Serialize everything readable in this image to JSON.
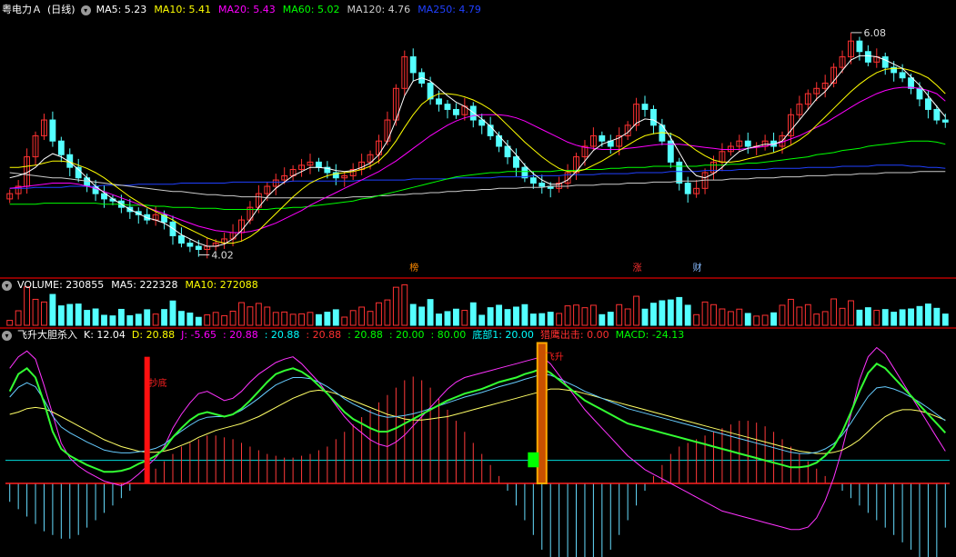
{
  "price_panel": {
    "header": {
      "name": "粤电力Ａ",
      "period": "(日线)",
      "ma": [
        {
          "label": "MA5: 5.23",
          "color": "#ffffff"
        },
        {
          "label": "MA10: 5.41",
          "color": "#ffff00"
        },
        {
          "label": "MA20: 5.43",
          "color": "#ff00ff"
        },
        {
          "label": "MA60: 5.02",
          "color": "#00ff00"
        },
        {
          "label": "MA120: 4.76",
          "color": "#cccccc"
        },
        {
          "label": "MA250: 4.79",
          "color": "#2040ff"
        }
      ]
    },
    "high_label": "6.08",
    "low_label": "4.02",
    "markers": [
      {
        "text": "榜",
        "color": "#ff8a00"
      },
      {
        "text": "涨",
        "color": "#ff3030"
      },
      {
        "text": "财",
        "color": "#88bbff"
      }
    ]
  },
  "volume_panel": {
    "header": [
      {
        "label": "VOLUME: 230855",
        "color": "#ffffff"
      },
      {
        "label": "MA5: 222328",
        "color": "#ffffff"
      },
      {
        "label": "MA10: 272088",
        "color": "#ffff00"
      }
    ]
  },
  "indicator_panel": {
    "header": [
      {
        "label": "飞升大胆杀入",
        "color": "#ffffff"
      },
      {
        "label": "K: 12.04",
        "color": "#ffffff"
      },
      {
        "label": "D: 20.88",
        "color": "#ffff00"
      },
      {
        "label": "J: -5.65",
        "color": "#ff00ff"
      },
      {
        "label": ": 20.88",
        "color": "#ff00ff"
      },
      {
        "label": ": 20.88",
        "color": "#00ffff"
      },
      {
        "label": ": 20.88",
        "color": "#ff3030"
      },
      {
        "label": ": 20.88",
        "color": "#00ff00"
      },
      {
        "label": ": 20.00",
        "color": "#00ff00"
      },
      {
        "label": ": 80.00",
        "color": "#00ff00"
      },
      {
        "label": "底部1: 20.00",
        "color": "#00ffff"
      },
      {
        "label": "猎鹰出击: 0.00",
        "color": "#ff3030"
      },
      {
        "label": "MACD: -24.13",
        "color": "#00ff00"
      }
    ],
    "signal_labels": [
      {
        "text": "抄底",
        "color": "#ff2020"
      },
      {
        "text": "飞升",
        "color": "#ff2020"
      }
    ]
  },
  "chart_data": {
    "type": "candlestick",
    "price": {
      "ylim": [
        3.8,
        6.2
      ],
      "max_point": {
        "value": 6.08
      },
      "min_point": {
        "value": 4.02
      },
      "closes": [
        4.55,
        4.62,
        4.9,
        5.1,
        5.25,
        5.05,
        4.92,
        4.8,
        4.7,
        4.62,
        4.55,
        4.5,
        4.48,
        4.42,
        4.38,
        4.35,
        4.3,
        4.35,
        4.28,
        4.15,
        4.08,
        4.05,
        4.02,
        4.05,
        4.08,
        4.12,
        4.18,
        4.3,
        4.42,
        4.55,
        4.62,
        4.68,
        4.72,
        4.78,
        4.82,
        4.85,
        4.8,
        4.75,
        4.7,
        4.72,
        4.78,
        4.85,
        4.92,
        5.05,
        5.25,
        5.55,
        5.85,
        5.7,
        5.6,
        5.45,
        5.4,
        5.35,
        5.3,
        5.38,
        5.25,
        5.2,
        5.1,
        5.0,
        4.9,
        4.8,
        4.7,
        4.65,
        4.62,
        4.6,
        4.65,
        4.75,
        4.9,
        5.0,
        5.1,
        5.05,
        5.0,
        5.1,
        5.2,
        5.4,
        5.35,
        5.2,
        5.05,
        4.85,
        4.65,
        4.55,
        4.6,
        4.75,
        4.85,
        4.95,
        5.0,
        5.05,
        5.0,
        5.0,
        5.05,
        5.0,
        5.1,
        5.3,
        5.4,
        5.5,
        5.55,
        5.6,
        5.75,
        5.85,
        6.0,
        5.9,
        5.8,
        5.85,
        5.75,
        5.7,
        5.65,
        5.55,
        5.45,
        5.35,
        5.25,
        5.23
      ],
      "ma5": [
        4.7,
        4.72,
        4.75,
        4.8,
        4.88,
        4.93,
        4.9,
        4.85,
        4.78,
        4.7,
        4.62,
        4.56,
        4.5,
        4.45,
        4.4,
        4.36,
        4.32,
        4.3,
        4.27,
        4.22,
        4.16,
        4.12,
        4.08,
        4.05,
        4.05,
        4.07,
        4.12,
        4.2,
        4.3,
        4.42,
        4.52,
        4.6,
        4.66,
        4.72,
        4.76,
        4.8,
        4.8,
        4.79,
        4.77,
        4.76,
        4.77,
        4.8,
        4.84,
        4.92,
        5.05,
        5.25,
        5.48,
        5.62,
        5.65,
        5.62,
        5.55,
        5.48,
        5.42,
        5.38,
        5.32,
        5.26,
        5.19,
        5.1,
        5.01,
        4.92,
        4.82,
        4.74,
        4.68,
        4.64,
        4.64,
        4.68,
        4.76,
        4.86,
        4.96,
        5.02,
        5.05,
        5.08,
        5.13,
        5.22,
        5.26,
        5.25,
        5.2,
        5.08,
        4.94,
        4.8,
        4.72,
        4.7,
        4.74,
        4.8,
        4.88,
        4.95,
        4.98,
        5.0,
        5.02,
        5.02,
        5.05,
        5.15,
        5.25,
        5.35,
        5.45,
        5.52,
        5.62,
        5.72,
        5.82,
        5.86,
        5.86,
        5.85,
        5.82,
        5.78,
        5.74,
        5.66,
        5.58,
        5.48,
        5.38,
        5.28
      ],
      "ma10": [
        4.8,
        4.8,
        4.81,
        4.82,
        4.84,
        4.86,
        4.86,
        4.85,
        4.82,
        4.79,
        4.75,
        4.7,
        4.64,
        4.58,
        4.52,
        4.47,
        4.42,
        4.38,
        4.34,
        4.3,
        4.25,
        4.21,
        4.17,
        4.13,
        4.1,
        4.08,
        4.08,
        4.1,
        4.14,
        4.2,
        4.28,
        4.36,
        4.44,
        4.52,
        4.59,
        4.65,
        4.69,
        4.72,
        4.74,
        4.75,
        4.76,
        4.78,
        4.81,
        4.86,
        4.94,
        5.05,
        5.18,
        5.3,
        5.4,
        5.46,
        5.5,
        5.5,
        5.49,
        5.47,
        5.44,
        5.4,
        5.35,
        5.28,
        5.2,
        5.12,
        5.04,
        4.97,
        4.9,
        4.84,
        4.79,
        4.76,
        4.76,
        4.78,
        4.82,
        4.86,
        4.91,
        4.96,
        5.01,
        5.06,
        5.1,
        5.12,
        5.13,
        5.12,
        5.08,
        5.02,
        4.96,
        4.91,
        4.87,
        4.85,
        4.85,
        4.86,
        4.88,
        4.9,
        4.92,
        4.94,
        4.97,
        5.01,
        5.06,
        5.12,
        5.2,
        5.28,
        5.36,
        5.44,
        5.52,
        5.59,
        5.65,
        5.7,
        5.73,
        5.74,
        5.74,
        5.72,
        5.69,
        5.65,
        5.58,
        5.5
      ],
      "ma20": [
        4.6,
        4.61,
        4.62,
        4.63,
        4.64,
        4.65,
        4.65,
        4.65,
        4.64,
        4.62,
        4.6,
        4.57,
        4.54,
        4.51,
        4.48,
        4.45,
        4.42,
        4.39,
        4.36,
        4.33,
        4.3,
        4.27,
        4.24,
        4.22,
        4.2,
        4.19,
        4.18,
        4.18,
        4.19,
        4.21,
        4.24,
        4.27,
        4.31,
        4.35,
        4.39,
        4.44,
        4.48,
        4.52,
        4.56,
        4.6,
        4.64,
        4.68,
        4.72,
        4.76,
        4.81,
        4.86,
        4.92,
        4.98,
        5.04,
        5.1,
        5.15,
        5.2,
        5.24,
        5.27,
        5.29,
        5.3,
        5.3,
        5.3,
        5.29,
        5.27,
        5.24,
        5.2,
        5.16,
        5.12,
        5.08,
        5.04,
        5.01,
        4.99,
        4.98,
        4.97,
        4.97,
        4.97,
        4.98,
        4.99,
        5.0,
        5.01,
        5.02,
        5.02,
        5.02,
        5.01,
        5.0,
        4.99,
        4.98,
        4.97,
        4.97,
        4.97,
        4.98,
        4.99,
        5.0,
        5.02,
        5.04,
        5.07,
        5.1,
        5.14,
        5.18,
        5.22,
        5.27,
        5.32,
        5.37,
        5.42,
        5.46,
        5.5,
        5.53,
        5.55,
        5.56,
        5.56,
        5.55,
        5.53,
        5.5,
        5.43
      ],
      "ma60": [
        4.45,
        4.45,
        4.45,
        4.45,
        4.46,
        4.46,
        4.46,
        4.46,
        4.46,
        4.46,
        4.46,
        4.45,
        4.45,
        4.45,
        4.44,
        4.44,
        4.44,
        4.43,
        4.43,
        4.42,
        4.42,
        4.42,
        4.41,
        4.41,
        4.41,
        4.4,
        4.4,
        4.4,
        4.4,
        4.4,
        4.4,
        4.41,
        4.41,
        4.42,
        4.42,
        4.43,
        4.44,
        4.45,
        4.46,
        4.47,
        4.48,
        4.5,
        4.51,
        4.53,
        4.55,
        4.57,
        4.59,
        4.61,
        4.63,
        4.65,
        4.67,
        4.69,
        4.71,
        4.72,
        4.73,
        4.74,
        4.75,
        4.75,
        4.76,
        4.76,
        4.76,
        4.76,
        4.76,
        4.76,
        4.77,
        4.77,
        4.77,
        4.78,
        4.78,
        4.78,
        4.79,
        4.79,
        4.8,
        4.8,
        4.8,
        4.81,
        4.81,
        4.81,
        4.81,
        4.81,
        4.81,
        4.82,
        4.82,
        4.82,
        4.83,
        4.83,
        4.84,
        4.84,
        4.85,
        4.86,
        4.87,
        4.88,
        4.89,
        4.9,
        4.92,
        4.93,
        4.94,
        4.96,
        4.97,
        4.98,
        5.0,
        5.01,
        5.02,
        5.03,
        5.04,
        5.05,
        5.05,
        5.05,
        5.04,
        5.02
      ],
      "ma120": [
        4.75,
        4.74,
        4.73,
        4.72,
        4.71,
        4.7,
        4.7,
        4.69,
        4.68,
        4.67,
        4.66,
        4.65,
        4.64,
        4.63,
        4.62,
        4.61,
        4.6,
        4.59,
        4.58,
        4.57,
        4.57,
        4.56,
        4.55,
        4.54,
        4.54,
        4.53,
        4.53,
        4.52,
        4.52,
        4.52,
        4.51,
        4.51,
        4.51,
        4.51,
        4.51,
        4.51,
        4.51,
        4.51,
        4.51,
        4.51,
        4.52,
        4.52,
        4.52,
        4.53,
        4.53,
        4.54,
        4.54,
        4.55,
        4.55,
        4.56,
        4.56,
        4.57,
        4.57,
        4.58,
        4.58,
        4.59,
        4.59,
        4.6,
        4.6,
        4.6,
        4.61,
        4.61,
        4.61,
        4.62,
        4.62,
        4.62,
        4.63,
        4.63,
        4.63,
        4.64,
        4.64,
        4.64,
        4.65,
        4.65,
        4.65,
        4.66,
        4.66,
        4.66,
        4.67,
        4.67,
        4.67,
        4.68,
        4.68,
        4.68,
        4.69,
        4.69,
        4.69,
        4.7,
        4.7,
        4.7,
        4.71,
        4.71,
        4.71,
        4.72,
        4.72,
        4.72,
        4.73,
        4.73,
        4.73,
        4.74,
        4.74,
        4.74,
        4.75,
        4.75,
        4.75,
        4.75,
        4.76,
        4.76,
        4.76,
        4.76
      ],
      "ma250": [
        4.6,
        4.6,
        4.6,
        4.61,
        4.61,
        4.61,
        4.61,
        4.62,
        4.62,
        4.62,
        4.62,
        4.63,
        4.63,
        4.63,
        4.63,
        4.64,
        4.64,
        4.64,
        4.64,
        4.64,
        4.65,
        4.65,
        4.65,
        4.65,
        4.65,
        4.65,
        4.66,
        4.66,
        4.66,
        4.66,
        4.66,
        4.66,
        4.66,
        4.67,
        4.67,
        4.67,
        4.67,
        4.67,
        4.67,
        4.67,
        4.67,
        4.68,
        4.68,
        4.68,
        4.68,
        4.68,
        4.68,
        4.69,
        4.69,
        4.69,
        4.69,
        4.69,
        4.7,
        4.7,
        4.7,
        4.7,
        4.7,
        4.71,
        4.71,
        4.71,
        4.71,
        4.72,
        4.72,
        4.72,
        4.72,
        4.73,
        4.73,
        4.73,
        4.73,
        4.74,
        4.74,
        4.74,
        4.74,
        4.75,
        4.75,
        4.75,
        4.75,
        4.76,
        4.76,
        4.76,
        4.76,
        4.77,
        4.77,
        4.77,
        4.77,
        4.78,
        4.78,
        4.78,
        4.78,
        4.79,
        4.79,
        4.79,
        4.79,
        4.8,
        4.8,
        4.8,
        4.8,
        4.81,
        4.81,
        4.81,
        4.81,
        4.82,
        4.82,
        4.82,
        4.82,
        4.81,
        4.81,
        4.8,
        4.8,
        4.79
      ]
    },
    "volume": {
      "ylim": [
        0,
        800000
      ],
      "last": 230855
    },
    "indicator": {
      "ylim": [
        -60,
        120
      ],
      "baseline": 0,
      "reference": 20,
      "k": [
        80,
        95,
        100,
        92,
        70,
        45,
        30,
        24,
        20,
        16,
        13,
        10,
        10,
        11,
        13,
        17,
        20,
        24,
        30,
        40,
        48,
        55,
        60,
        62,
        60,
        58,
        60,
        65,
        72,
        80,
        88,
        95,
        98,
        100,
        97,
        92,
        85,
        78,
        70,
        62,
        56,
        52,
        48,
        45,
        45,
        48,
        52,
        56,
        60,
        64,
        68,
        72,
        75,
        78,
        80,
        82,
        85,
        88,
        90,
        92,
        95,
        97,
        100,
        96,
        90,
        84,
        78,
        72,
        68,
        64,
        60,
        56,
        52,
        50,
        48,
        46,
        44,
        42,
        40,
        38,
        36,
        34,
        32,
        30,
        28,
        26,
        24,
        22,
        20,
        18,
        16,
        14,
        14,
        15,
        18,
        24,
        32,
        45,
        62,
        80,
        96,
        104,
        100,
        92,
        84,
        76,
        68,
        60,
        52,
        44
      ],
      "d": [
        60,
        62,
        65,
        66,
        65,
        62,
        58,
        54,
        50,
        46,
        42,
        38,
        35,
        32,
        30,
        28,
        27,
        27,
        28,
        30,
        33,
        36,
        40,
        43,
        46,
        48,
        50,
        52,
        55,
        58,
        62,
        66,
        70,
        74,
        77,
        80,
        81,
        80,
        78,
        75,
        72,
        69,
        66,
        63,
        60,
        58,
        56,
        55,
        55,
        56,
        57,
        58,
        60,
        62,
        64,
        66,
        68,
        70,
        72,
        74,
        76,
        78,
        80,
        82,
        82,
        81,
        80,
        78,
        76,
        74,
        72,
        70,
        68,
        66,
        64,
        62,
        60,
        58,
        56,
        54,
        52,
        50,
        48,
        46,
        44,
        42,
        40,
        38,
        36,
        34,
        32,
        30,
        28,
        27,
        26,
        26,
        27,
        29,
        33,
        38,
        45,
        52,
        58,
        62,
        64,
        64,
        63,
        61,
        58,
        55
      ],
      "j": [
        100,
        110,
        115,
        108,
        85,
        60,
        35,
        22,
        15,
        10,
        6,
        2,
        0,
        -2,
        2,
        8,
        15,
        22,
        32,
        48,
        60,
        70,
        78,
        80,
        76,
        72,
        74,
        80,
        88,
        95,
        100,
        105,
        108,
        110,
        104,
        96,
        88,
        78,
        68,
        58,
        50,
        44,
        38,
        34,
        32,
        36,
        42,
        50,
        58,
        66,
        74,
        82,
        88,
        92,
        94,
        96,
        98,
        100,
        102,
        104,
        106,
        108,
        110,
        104,
        94,
        84,
        74,
        64,
        56,
        48,
        40,
        32,
        24,
        18,
        12,
        8,
        4,
        0,
        -4,
        -8,
        -12,
        -16,
        -20,
        -24,
        -26,
        -28,
        -30,
        -32,
        -34,
        -36,
        -38,
        -40,
        -40,
        -38,
        -30,
        -15,
        5,
        30,
        60,
        90,
        110,
        118,
        112,
        100,
        88,
        76,
        64,
        52,
        40,
        28
      ],
      "macd": [
        -10,
        -14,
        -18,
        -22,
        -26,
        -28,
        -30,
        -30,
        -28,
        -24,
        -20,
        -16,
        -12,
        -8,
        -4,
        0,
        4,
        8,
        12,
        16,
        20,
        22,
        24,
        26,
        26,
        25,
        24,
        22,
        20,
        18,
        16,
        15,
        14,
        14,
        15,
        16,
        18,
        20,
        24,
        28,
        32,
        36,
        40,
        44,
        48,
        52,
        56,
        58,
        56,
        52,
        46,
        40,
        34,
        28,
        22,
        16,
        10,
        4,
        -4,
        -12,
        -20,
        -28,
        -36,
        -44,
        -50,
        -56,
        -60,
        -58,
        -52,
        -44,
        -36,
        -28,
        -20,
        -12,
        -4,
        4,
        10,
        16,
        20,
        22,
        24,
        26,
        28,
        30,
        32,
        34,
        34,
        33,
        31,
        28,
        24,
        20,
        16,
        12,
        8,
        4,
        0,
        -4,
        -8,
        -12,
        -16,
        -20,
        -24,
        -28,
        -32,
        -36,
        -40,
        -44,
        -48,
        -24
      ]
    }
  }
}
